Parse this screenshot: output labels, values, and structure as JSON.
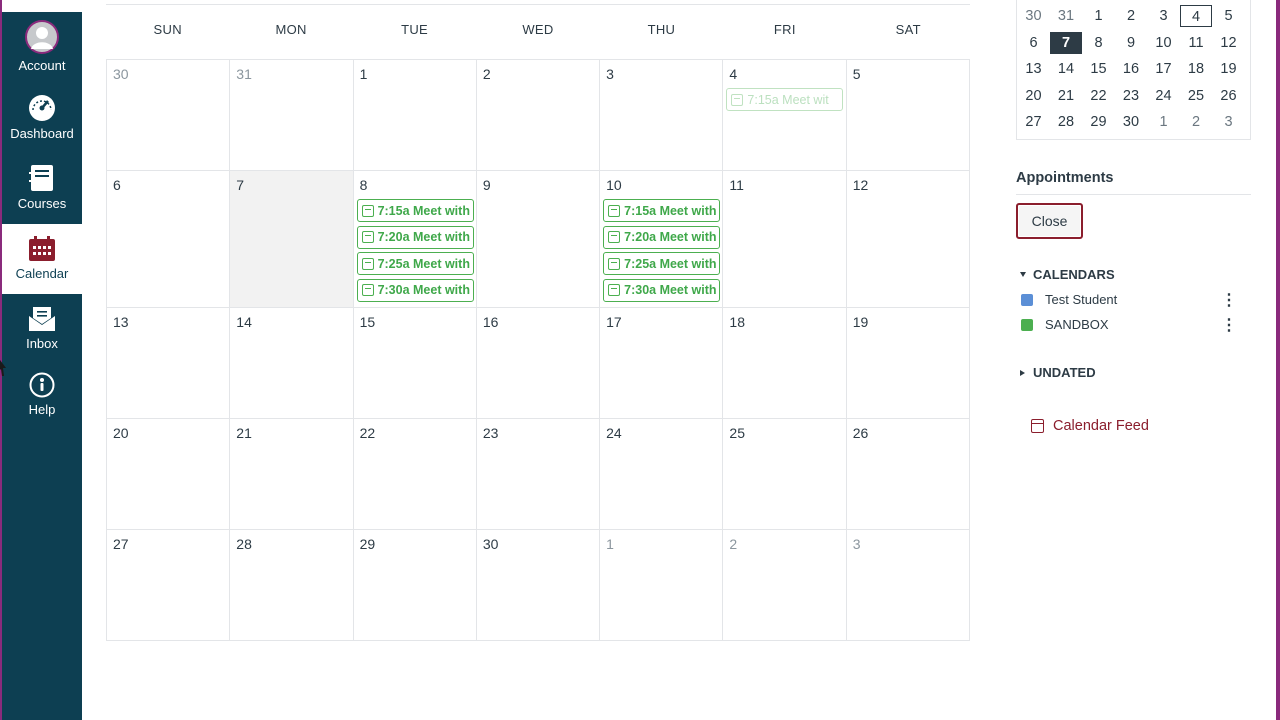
{
  "nav": {
    "account": "Account",
    "dashboard": "Dashboard",
    "courses": "Courses",
    "calendar": "Calendar",
    "inbox": "Inbox",
    "help": "Help"
  },
  "weekdays": [
    "SUN",
    "MON",
    "TUE",
    "WED",
    "THU",
    "FRI",
    "SAT"
  ],
  "weeks": [
    {
      "days": [
        {
          "n": "30",
          "other": true
        },
        {
          "n": "31",
          "other": true
        },
        {
          "n": "1"
        },
        {
          "n": "2"
        },
        {
          "n": "3"
        },
        {
          "n": "4",
          "events": [
            {
              "t": "7:15a Meet wit",
              "faded": true
            }
          ]
        },
        {
          "n": "5"
        }
      ]
    },
    {
      "days": [
        {
          "n": "6"
        },
        {
          "n": "7",
          "today": true
        },
        {
          "n": "8",
          "events": [
            {
              "t": "7:15a Meet with"
            },
            {
              "t": "7:20a Meet with"
            },
            {
              "t": "7:25a Meet with"
            },
            {
              "t": "7:30a Meet with"
            }
          ]
        },
        {
          "n": "9"
        },
        {
          "n": "10",
          "events": [
            {
              "t": "7:15a Meet with"
            },
            {
              "t": "7:20a Meet with"
            },
            {
              "t": "7:25a Meet with"
            },
            {
              "t": "7:30a Meet with"
            }
          ]
        },
        {
          "n": "11"
        },
        {
          "n": "12"
        }
      ]
    },
    {
      "days": [
        {
          "n": "13"
        },
        {
          "n": "14"
        },
        {
          "n": "15"
        },
        {
          "n": "16"
        },
        {
          "n": "17"
        },
        {
          "n": "18"
        },
        {
          "n": "19"
        }
      ]
    },
    {
      "days": [
        {
          "n": "20"
        },
        {
          "n": "21"
        },
        {
          "n": "22"
        },
        {
          "n": "23"
        },
        {
          "n": "24"
        },
        {
          "n": "25"
        },
        {
          "n": "26"
        }
      ]
    },
    {
      "days": [
        {
          "n": "27"
        },
        {
          "n": "28"
        },
        {
          "n": "29"
        },
        {
          "n": "30"
        },
        {
          "n": "1",
          "other": true
        },
        {
          "n": "2",
          "other": true
        },
        {
          "n": "3",
          "other": true
        }
      ]
    }
  ],
  "mini_calendar": [
    [
      {
        "n": "30",
        "other": true
      },
      {
        "n": "31",
        "other": true
      },
      {
        "n": "1"
      },
      {
        "n": "2"
      },
      {
        "n": "3"
      },
      {
        "n": "4",
        "boxed": true
      },
      {
        "n": "5"
      }
    ],
    [
      {
        "n": "6"
      },
      {
        "n": "7",
        "selected": true
      },
      {
        "n": "8"
      },
      {
        "n": "9"
      },
      {
        "n": "10"
      },
      {
        "n": "11"
      },
      {
        "n": "12"
      }
    ],
    [
      {
        "n": "13"
      },
      {
        "n": "14"
      },
      {
        "n": "15"
      },
      {
        "n": "16"
      },
      {
        "n": "17"
      },
      {
        "n": "18"
      },
      {
        "n": "19"
      }
    ],
    [
      {
        "n": "20"
      },
      {
        "n": "21"
      },
      {
        "n": "22"
      },
      {
        "n": "23"
      },
      {
        "n": "24"
      },
      {
        "n": "25"
      },
      {
        "n": "26"
      }
    ],
    [
      {
        "n": "27"
      },
      {
        "n": "28"
      },
      {
        "n": "29"
      },
      {
        "n": "30"
      },
      {
        "n": "1",
        "other": true
      },
      {
        "n": "2",
        "other": true
      },
      {
        "n": "3",
        "other": true
      }
    ]
  ],
  "sidebar": {
    "appointments_title": "Appointments",
    "close_label": "Close",
    "calendars_heading": "CALENDARS",
    "calendars": [
      {
        "name": "Test Student",
        "color": "#5b8fd6"
      },
      {
        "name": "SANDBOX",
        "color": "#4caf50"
      }
    ],
    "undated_heading": "UNDATED",
    "feed_label": "Calendar Feed"
  },
  "colors": {
    "nav_bg": "#0d3f52",
    "event_green": "#3fa84a",
    "accent_red": "#8b1e2d",
    "account_purple": "#8a2a7c"
  }
}
